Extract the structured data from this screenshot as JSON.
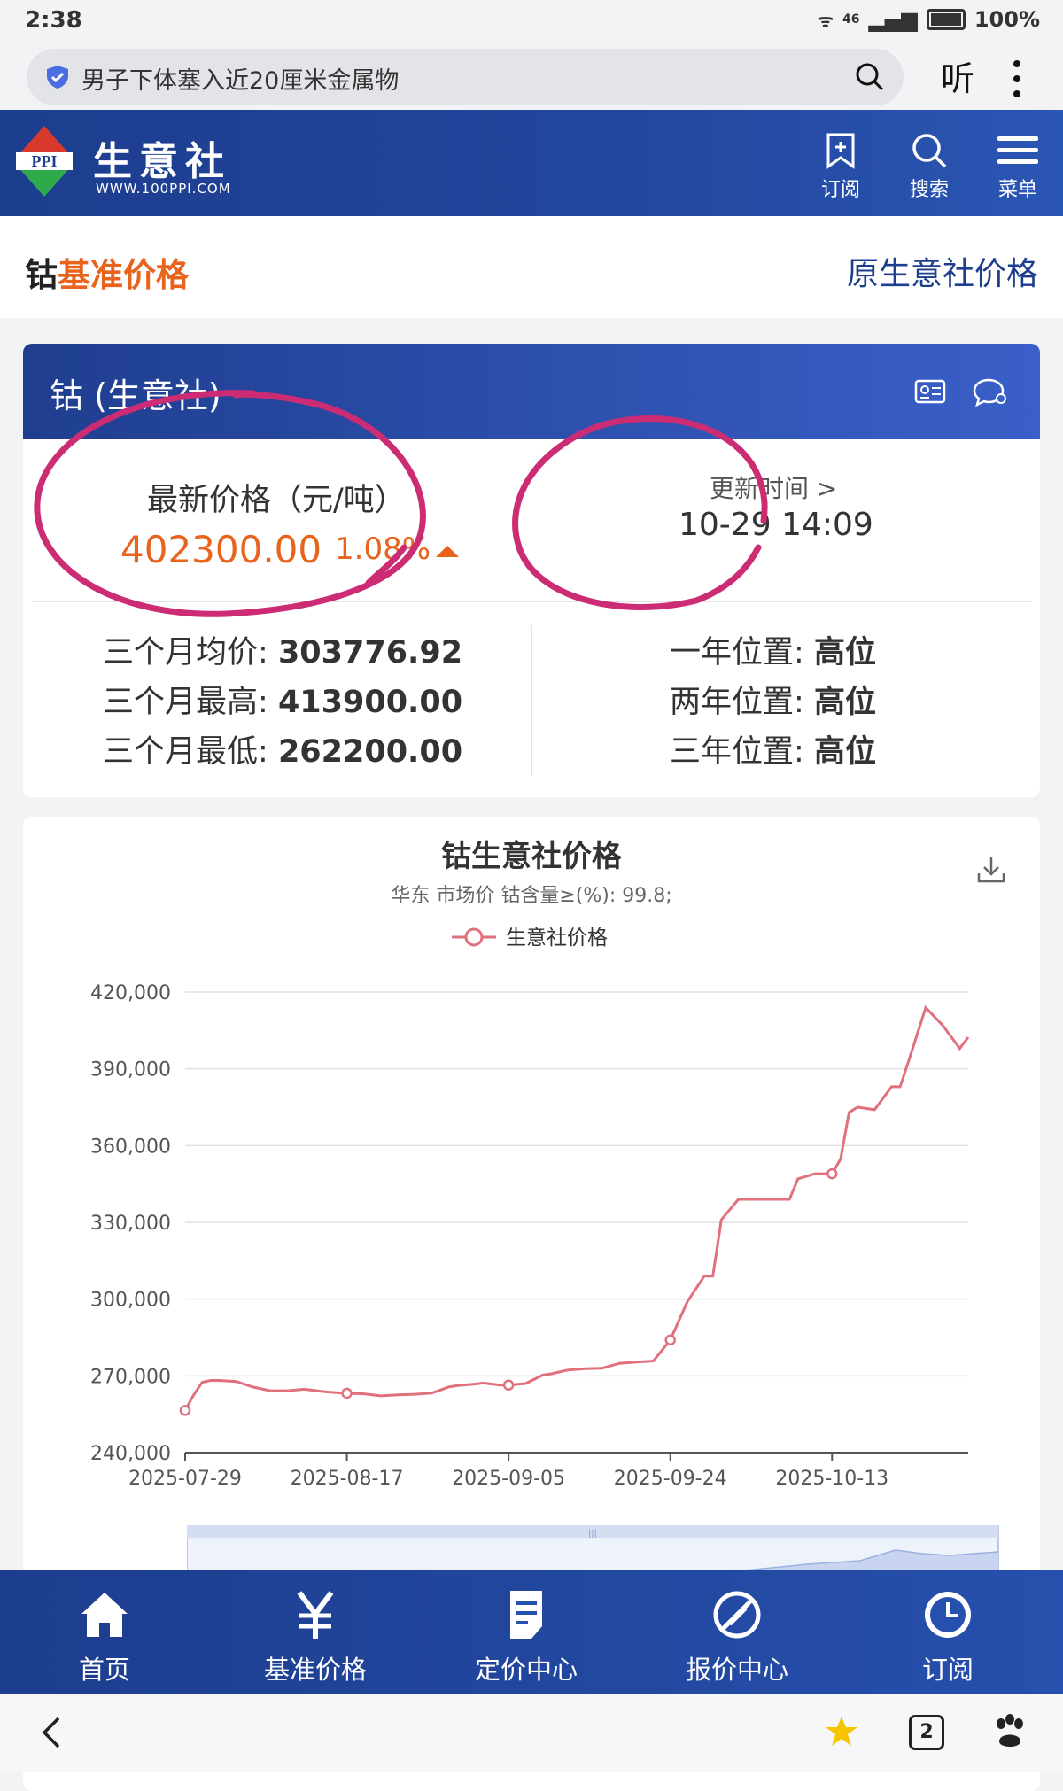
{
  "status_bar": {
    "time": "2:38",
    "signal": "46",
    "battery": "100%"
  },
  "address_bar": {
    "text": "男子下体塞入近20厘米金属物",
    "listen_label": "听"
  },
  "site_header": {
    "brand": "生意社",
    "logo_text": "PPI",
    "url": "WWW.100PPI.COM",
    "buttons": [
      {
        "label": "订阅",
        "icon": "bookmark-add-icon"
      },
      {
        "label": "搜索",
        "icon": "search-icon"
      },
      {
        "label": "菜单",
        "icon": "menu-icon"
      }
    ]
  },
  "page_title": {
    "prefix": "钴",
    "highlight": "基准价格",
    "link": "原生意社价格"
  },
  "info_card": {
    "header": "钴 (生意社)",
    "latest_label": "最新价格（元/吨）",
    "latest_price": "402300.00",
    "change_pct": "1.08%",
    "update_label": "更新时间 >",
    "update_time": "10-29 14:09",
    "stats_left": [
      {
        "label": "三个月均价:",
        "value": "303776.92"
      },
      {
        "label": "三个月最高:",
        "value": "413900.00"
      },
      {
        "label": "三个月最低:",
        "value": "262200.00"
      }
    ],
    "stats_right": [
      {
        "label": "一年位置:",
        "value": "高位"
      },
      {
        "label": "两年位置:",
        "value": "高位"
      },
      {
        "label": "三年位置:",
        "value": "高位"
      }
    ]
  },
  "chart_data": {
    "type": "line",
    "title": "钴生意社价格",
    "subtitle": "华东 市场价 钴含量≥(%): 99.8;",
    "legend": [
      "生意社价格"
    ],
    "legend_position": "top-center",
    "color": "#e0707c",
    "ylim": [
      240000,
      420000
    ],
    "yticks": [
      "240,000",
      "270,000",
      "300,000",
      "330,000",
      "360,000",
      "390,000",
      "420,000"
    ],
    "xticks": [
      "2025-07-29",
      "2025-08-17",
      "2025-09-05",
      "2025-09-24",
      "2025-10-13"
    ],
    "grid": true,
    "series": [
      {
        "name": "生意社价格",
        "x": [
          "2025-07-29",
          "2025-07-30",
          "2025-07-31",
          "2025-08-01",
          "2025-08-02",
          "2025-08-04",
          "2025-08-06",
          "2025-08-08",
          "2025-08-10",
          "2025-08-12",
          "2025-08-14",
          "2025-08-15",
          "2025-08-17",
          "2025-08-19",
          "2025-08-21",
          "2025-08-23",
          "2025-08-25",
          "2025-08-27",
          "2025-08-29",
          "2025-08-30",
          "2025-09-01",
          "2025-09-02",
          "2025-09-04",
          "2025-09-05",
          "2025-09-07",
          "2025-09-09",
          "2025-09-10",
          "2025-09-12",
          "2025-09-14",
          "2025-09-16",
          "2025-09-18",
          "2025-09-20",
          "2025-09-22",
          "2025-09-24",
          "2025-09-26",
          "2025-09-28",
          "2025-09-29",
          "2025-09-30",
          "2025-10-02",
          "2025-10-05",
          "2025-10-08",
          "2025-10-09",
          "2025-10-11",
          "2025-10-12",
          "2025-10-13",
          "2025-10-14",
          "2025-10-15",
          "2025-10-16",
          "2025-10-18",
          "2025-10-20",
          "2025-10-21",
          "2025-10-22",
          "2025-10-24",
          "2025-10-26",
          "2025-10-28",
          "2025-10-29"
        ],
        "values": [
          256500,
          262500,
          267500,
          268200,
          268200,
          267800,
          265600,
          264200,
          264200,
          264800,
          264000,
          263600,
          263200,
          263000,
          262200,
          262600,
          262800,
          263300,
          265700,
          266200,
          266800,
          267200,
          266400,
          266400,
          267000,
          270300,
          270800,
          272300,
          272800,
          273000,
          274900,
          275400,
          275800,
          284000,
          299000,
          309000,
          309000,
          331000,
          339000,
          339000,
          339000,
          347000,
          349000,
          349000,
          349000,
          354700,
          373000,
          375000,
          374000,
          383000,
          383000,
          393000,
          413900,
          407000,
          398000,
          402300
        ]
      }
    ]
  },
  "download_icon": "download-icon",
  "bottom_nav": [
    {
      "label": "首页",
      "icon": "home-icon"
    },
    {
      "label": "基准价格",
      "icon": "yuan-icon"
    },
    {
      "label": "定价中心",
      "icon": "document-icon"
    },
    {
      "label": "报价中心",
      "icon": "quote-icon"
    },
    {
      "label": "订阅",
      "icon": "clock-icon"
    }
  ],
  "system_bar": {
    "tabs_count": "2"
  }
}
